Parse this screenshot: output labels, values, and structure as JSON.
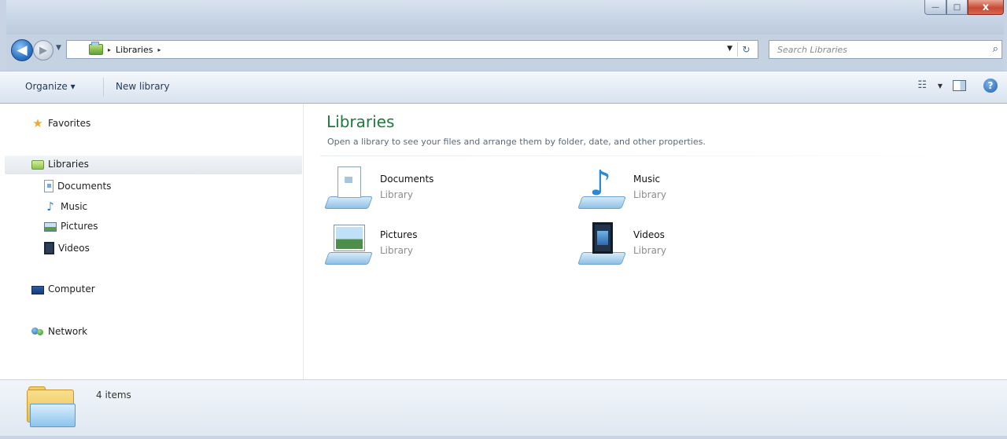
{
  "window": {
    "caption_buttons": {
      "minimize": "—",
      "maximize": "□",
      "close": "x"
    }
  },
  "nav": {
    "back_glyph": "◀",
    "forward_glyph": "▶",
    "recent_glyph": "▼",
    "breadcrumb": [
      {
        "label": "Libraries"
      }
    ],
    "crumb_sep": "▸",
    "dropdown_glyph": "▼",
    "refresh_glyph": "↻"
  },
  "search": {
    "placeholder": "Search Libraries",
    "icon_glyph": "⌕"
  },
  "toolbar": {
    "organize_label": "Organize ▾",
    "new_library_label": "New library",
    "views_glyph": "☷",
    "views_arrow": "▼",
    "help_glyph": "?"
  },
  "sidebar": {
    "favorites": "Favorites",
    "libraries": "Libraries",
    "library_items": [
      "Documents",
      "Music",
      "Pictures",
      "Videos"
    ],
    "computer": "Computer",
    "network": "Network",
    "star_glyph": "★",
    "music_glyph": "♪"
  },
  "main": {
    "title": "Libraries",
    "subtitle": "Open a library to see your files and arrange them by folder, date, and other properties.",
    "tiles": [
      {
        "name": "Documents",
        "type": "Library"
      },
      {
        "name": "Music",
        "type": "Library"
      },
      {
        "name": "Pictures",
        "type": "Library"
      },
      {
        "name": "Videos",
        "type": "Library"
      }
    ],
    "music_glyph": "♪"
  },
  "status": {
    "item_count": "4 items"
  }
}
